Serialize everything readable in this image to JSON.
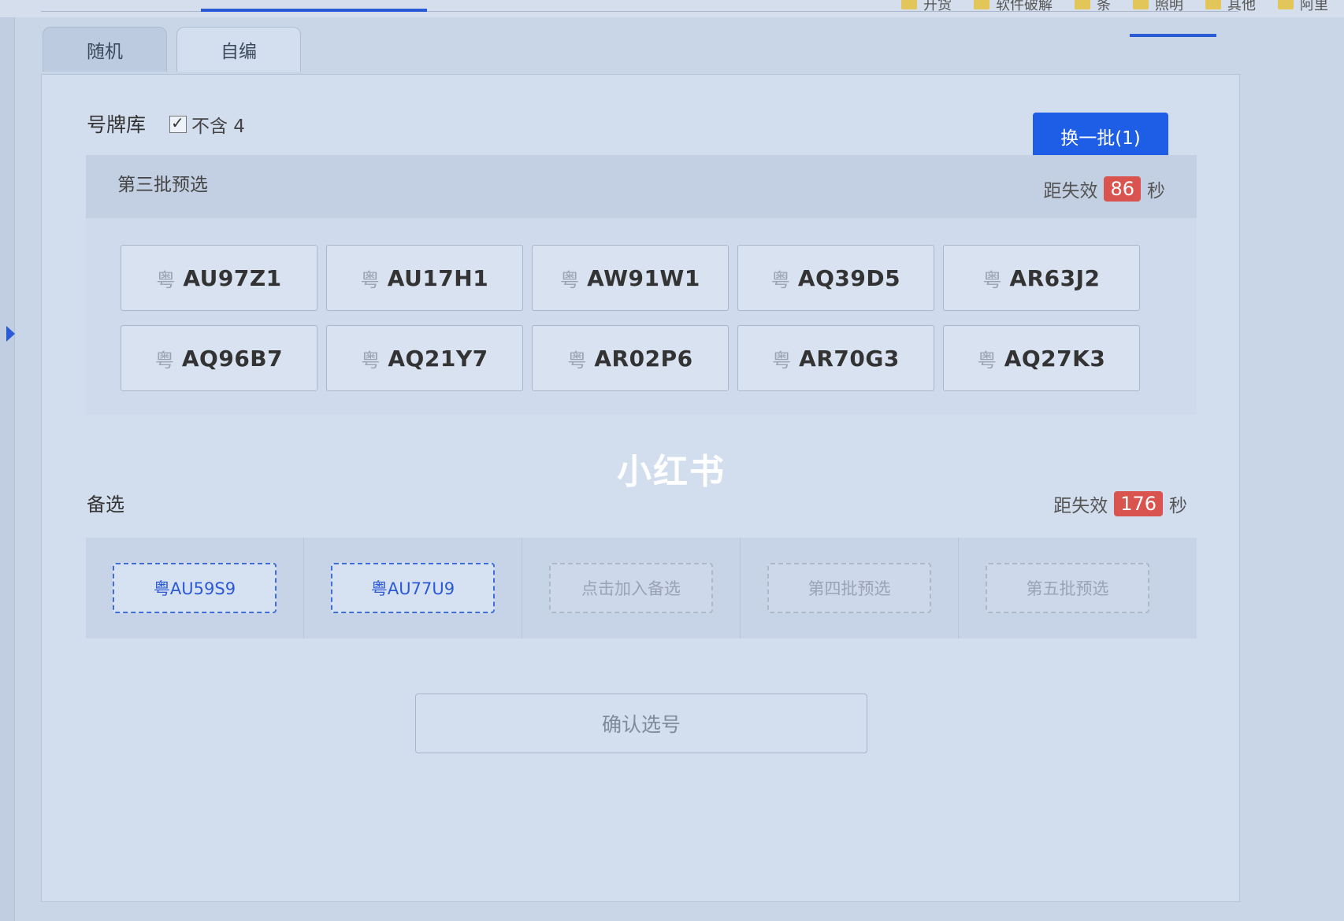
{
  "tabs": [
    {
      "label": "随机"
    },
    {
      "label": "自编"
    }
  ],
  "library": {
    "title": "号牌库",
    "exclude_label": "不含 4"
  },
  "swap_button": "换一批(1)",
  "batch": {
    "title": "第三批预选",
    "expire_label": "距失效",
    "seconds": "86",
    "unit": "秒",
    "plates": [
      {
        "prov": "粤",
        "num": "AU97Z1"
      },
      {
        "prov": "粤",
        "num": "AU17H1"
      },
      {
        "prov": "粤",
        "num": "AW91W1"
      },
      {
        "prov": "粤",
        "num": "AQ39D5"
      },
      {
        "prov": "粤",
        "num": "AR63J2"
      },
      {
        "prov": "粤",
        "num": "AQ96B7"
      },
      {
        "prov": "粤",
        "num": "AQ21Y7"
      },
      {
        "prov": "粤",
        "num": "AR02P6"
      },
      {
        "prov": "粤",
        "num": "AR70G3"
      },
      {
        "prov": "粤",
        "num": "AQ27K3"
      }
    ]
  },
  "backup": {
    "title": "备选",
    "expire_label": "距失效",
    "seconds": "176",
    "unit": "秒",
    "slots": [
      {
        "label": "粤AU59S9"
      },
      {
        "label": "粤AU77U9"
      },
      {
        "label": "点击加入备选"
      },
      {
        "label": "第四批预选"
      },
      {
        "label": "第五批预选"
      }
    ]
  },
  "confirm_button": "确认选号",
  "watermark": "小红书",
  "bookmarks": [
    {
      "label": "开货"
    },
    {
      "label": "软件破解"
    },
    {
      "label": "条"
    },
    {
      "label": "照明"
    },
    {
      "label": "其他"
    },
    {
      "label": "阿里"
    }
  ],
  "colors": {
    "primary": "#1e5de6",
    "badge": "#d9534f",
    "link": "#2c5ad6"
  }
}
